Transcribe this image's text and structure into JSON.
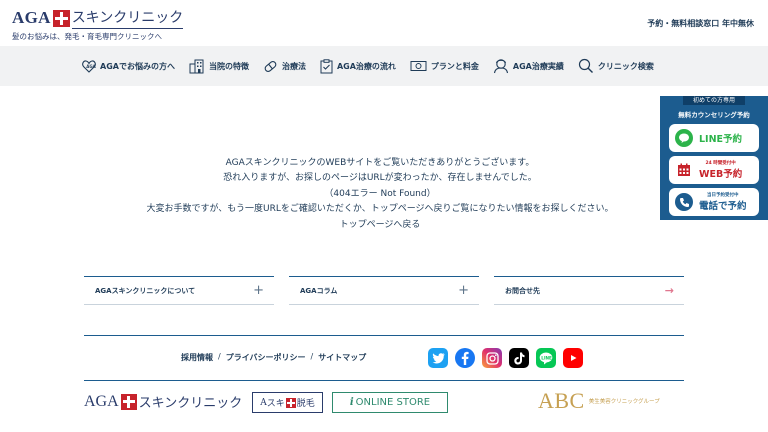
{
  "header": {
    "logo_aga": "AGA",
    "logo_text": "スキンクリニック",
    "tagline": "髪のお悩みは、発毛・育毛専門クリニックへ",
    "right_text": "予約・無料相談窓口 年中無休"
  },
  "nav": {
    "items": [
      {
        "label": "AGAでお悩みの方へ",
        "icon": "heart-icon"
      },
      {
        "label": "当院の特徴",
        "icon": "building-icon"
      },
      {
        "label": "治療法",
        "icon": "pill-icon"
      },
      {
        "label": "AGA治療の流れ",
        "icon": "clipboard-icon"
      },
      {
        "label": "プランと料金",
        "icon": "money-icon"
      },
      {
        "label": "AGA治療実績",
        "icon": "person-icon"
      },
      {
        "label": "クリニック検索",
        "icon": "search-icon"
      }
    ]
  },
  "side": {
    "tab": "初めての方専用",
    "title": "無料カウンセリング予約",
    "line_label": "LINE予約",
    "web_sub": "24 時間受付中",
    "web_label": "WEB予約",
    "tel_sub": "当日予約受付中",
    "tel_label": "電話で予約",
    "colors": {
      "line": "#2cb34a",
      "web": "#c7232b",
      "tel": "#1c5c8f"
    }
  },
  "message": {
    "line1": "AGAスキンクリニックのWEBサイトをご覧いただきありがとうございます。",
    "line2": "恐れ入りますが、お探しのページはURLが変わったか、存在しませんでした。",
    "line3": "（404エラー Not Found）",
    "line4": "大変お手数ですが、もう一度URLをご確認いただくか、トップページへ戻りご覧になりたい情報をお探しください。",
    "link": "トップページへ戻る"
  },
  "footer": {
    "box1": "AGAスキンクリニックについて",
    "box2": "AGAコラム",
    "box3": "お問合せ先",
    "links": [
      "採用情報",
      "プライバシーポリシー",
      "サイトマップ"
    ],
    "separator": "/",
    "sns": [
      "twitter-icon",
      "facebook-icon",
      "instagram-icon",
      "tiktok-icon",
      "line-icon",
      "youtube-icon"
    ],
    "brand_aga": "AGA",
    "brand_text": "スキンクリニック",
    "datsumo_a": "A",
    "datsumo_suki": "スキ",
    "datsumo_end": "脱毛",
    "store_prefix": "i",
    "store_text": "ONLINE STORE",
    "abc_big": "ABC",
    "abc_small": "美生美容クリニックグループ"
  }
}
